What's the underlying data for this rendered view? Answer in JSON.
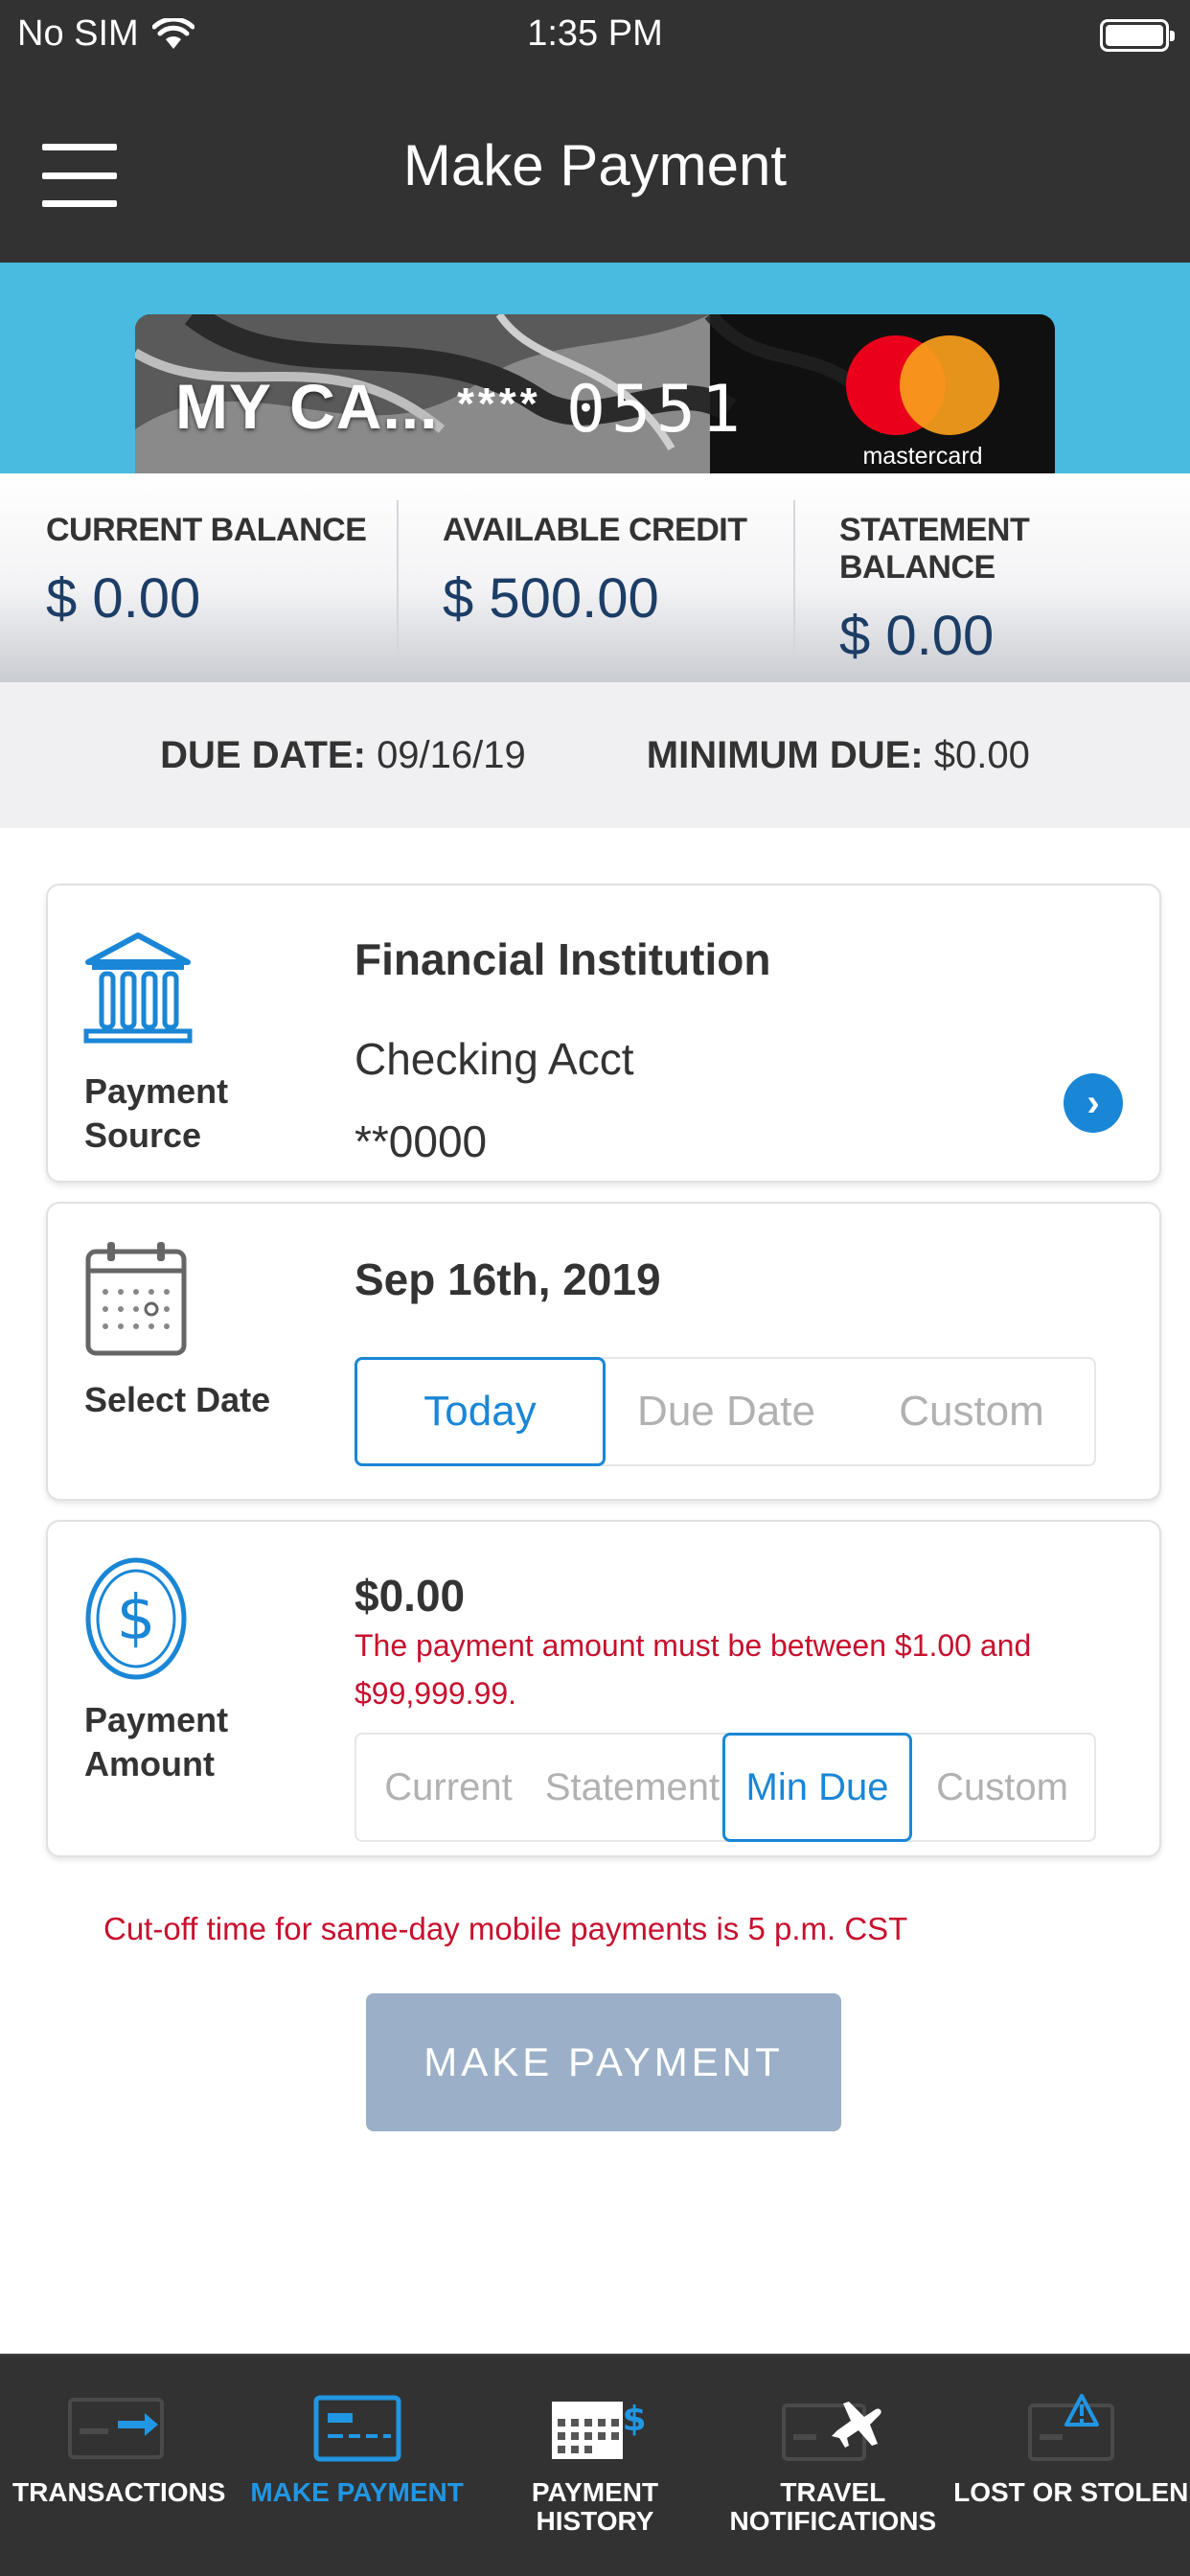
{
  "status_bar": {
    "carrier": "No SIM",
    "time": "1:35 PM"
  },
  "header": {
    "title": "Make Payment"
  },
  "card": {
    "name": "MY CA...",
    "masked": "****",
    "last4": "0551",
    "brand": "mastercard"
  },
  "balances": [
    {
      "label": "CURRENT BALANCE",
      "value": "$ 0.00"
    },
    {
      "label": "AVAILABLE CREDIT",
      "value": "$ 500.00"
    },
    {
      "label": "STATEMENT BALANCE",
      "value": "$ 0.00"
    }
  ],
  "due": {
    "date_label": "DUE DATE:",
    "date_value": "09/16/19",
    "min_label": "MINIMUM DUE:",
    "min_value": "$0.00"
  },
  "payment_source": {
    "caption": "Payment Source",
    "institution": "Financial Institution",
    "account_type": "Checking Acct",
    "account_number": "**0000"
  },
  "select_date": {
    "caption": "Select Date",
    "date": "Sep 16th, 2019",
    "options": [
      "Today",
      "Due Date",
      "Custom"
    ],
    "selected": "Today"
  },
  "payment_amount": {
    "caption": "Payment Amount",
    "amount": "$0.00",
    "error": "The payment amount must be between $1.00 and $99,999.99.",
    "options": [
      "Current",
      "Statement",
      "Min Due",
      "Custom"
    ],
    "selected": "Min Due"
  },
  "cutoff_notice": "Cut-off time for same-day mobile payments is 5 p.m. CST",
  "make_payment_button": "MAKE PAYMENT",
  "tabs": [
    {
      "label": "TRANSACTIONS",
      "icon": "transactions-icon"
    },
    {
      "label": "MAKE PAYMENT",
      "icon": "make-payment-icon"
    },
    {
      "label": "PAYMENT\nHISTORY",
      "icon": "payment-history-icon"
    },
    {
      "label": "TRAVEL\nNOTIFICATIONS",
      "icon": "travel-notifications-icon"
    },
    {
      "label": "LOST OR STOLEN",
      "icon": "lost-or-stolen-icon"
    }
  ],
  "colors": {
    "accent": "#1a86d6",
    "error": "#c8102e",
    "banner": "#49bbe0",
    "bar": "#323232",
    "button_disabled": "#9bb0c8"
  }
}
